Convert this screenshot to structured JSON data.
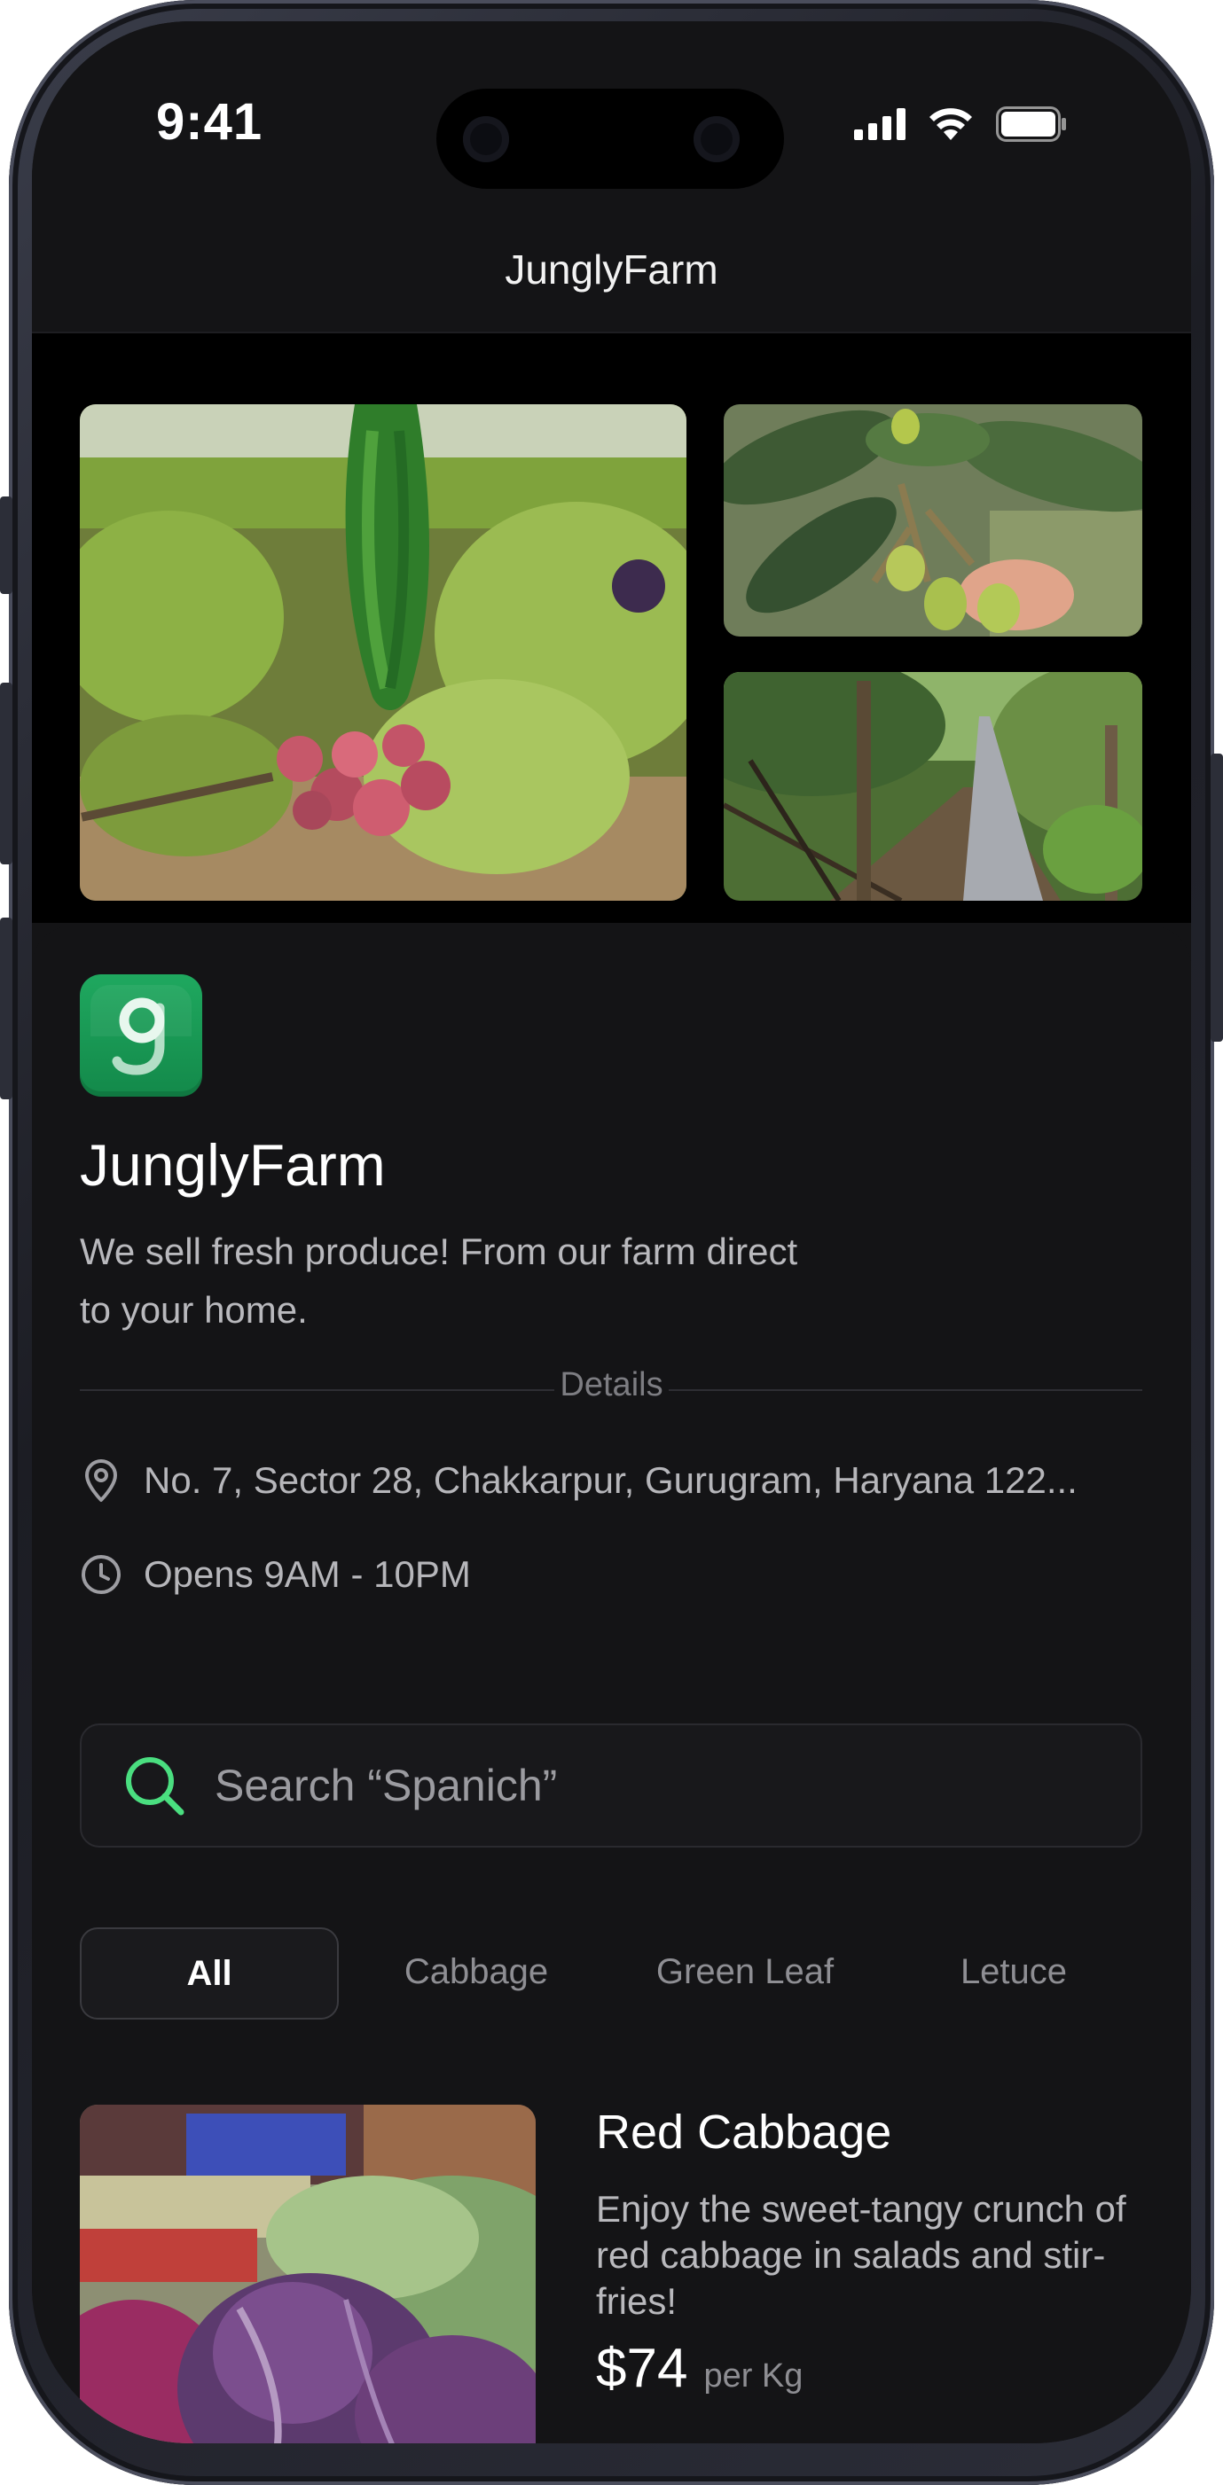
{
  "status_bar": {
    "time": "9:41"
  },
  "header": {
    "title": "JunglyFarm"
  },
  "gallery": {
    "main_photo": "onion-harvest-photo",
    "top_right_photo": "fruit-tree-photo",
    "bottom_right_photo": "greenhouse-path-photo"
  },
  "store": {
    "logo_letter": "g",
    "name": "JunglyFarm",
    "description": "We sell fresh produce! From our farm direct to your home.",
    "details_label": "Details",
    "address": "No. 7, Sector 28, Chakkarpur, Gurugram, Haryana 122...",
    "hours": "Opens  9AM - 10PM"
  },
  "search": {
    "placeholder": "Search “Spanich”"
  },
  "filters": [
    {
      "label": "All",
      "active": true
    },
    {
      "label": "Cabbage",
      "active": false
    },
    {
      "label": "Green Leaf",
      "active": false
    },
    {
      "label": "Letuce",
      "active": false
    }
  ],
  "products": [
    {
      "name": "Red Cabbage",
      "description": "Enjoy the sweet-tangy crunch of red cabbage in salads and stir-fries!",
      "price": "$74",
      "unit": "per Kg"
    }
  ],
  "colors": {
    "background": "#141416",
    "accent_green": "#1fa85f",
    "search_icon": "#4ade80"
  }
}
